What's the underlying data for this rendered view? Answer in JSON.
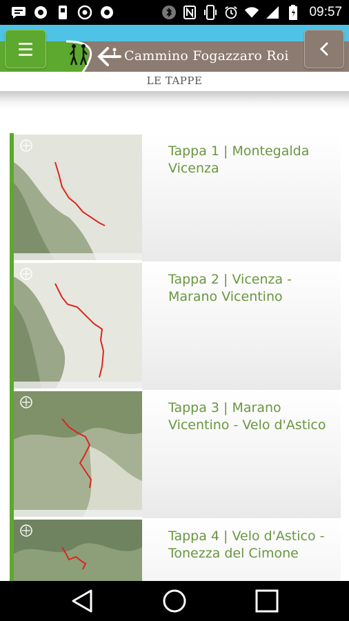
{
  "status_bar": {
    "time": "09:57",
    "icons_left": [
      "message-icon",
      "app-icon",
      "usb-icon",
      "chrome-icon",
      "app-icon"
    ],
    "icons_right": [
      "bluetooth-icon",
      "nfc-icon",
      "vibrate-icon",
      "alarm-icon",
      "wifi-icon",
      "signal-icon",
      "battery-icon"
    ]
  },
  "header": {
    "title": "Cammino Fogazzaro Roi",
    "menu_icon": "hamburger-icon",
    "back_icon": "chevron-left-icon",
    "colors": {
      "sky": "#4ec3e6",
      "green": "#5da82e",
      "brown": "#8c7b71"
    }
  },
  "subtitle": "LE TAPPE",
  "stages": [
    {
      "title": "Tappa 1 | Montegalda Vicenza"
    },
    {
      "title": "Tappa 2 | Vicenza - Marano Vicentino"
    },
    {
      "title": "Tappa 3 | Marano Vicentino - Velo d'Astico"
    },
    {
      "title": "Tappa 4 | Velo d'Astico - Tonezza del Cimone"
    }
  ],
  "nav": {
    "back": "back-triangle-icon",
    "home": "home-circle-icon",
    "recents": "recents-square-icon"
  }
}
